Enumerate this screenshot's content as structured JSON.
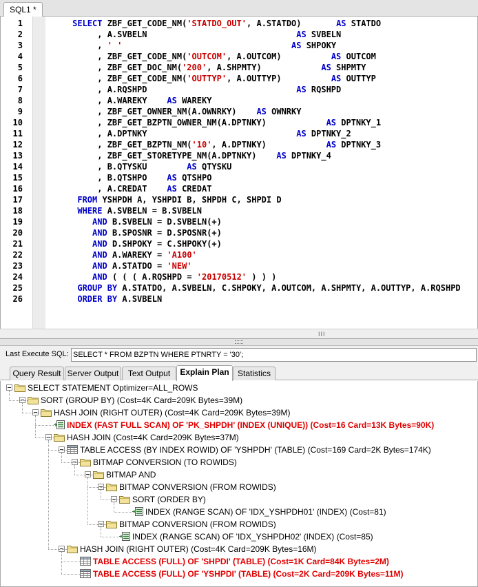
{
  "editor": {
    "tab_label": "SQL1 *",
    "scroll_grip": "III",
    "lines": [
      {
        "n": "1",
        "t": [
          [
            "     "
          ],
          [
            "SELECT",
            "kw"
          ],
          [
            " ZBF_GET_CODE_NM("
          ],
          [
            "'STATDO_OUT'",
            "str"
          ],
          [
            ", A.STATDO)       "
          ],
          [
            "AS",
            "kw"
          ],
          [
            " STATDO"
          ]
        ]
      },
      {
        "n": "2",
        "t": [
          [
            "          , A.SVBELN                              "
          ],
          [
            "AS",
            "kw"
          ],
          [
            " SVBELN"
          ]
        ]
      },
      {
        "n": "3",
        "t": [
          [
            "          , "
          ],
          [
            "' '",
            "str"
          ],
          [
            "                                  "
          ],
          [
            "AS",
            "kw"
          ],
          [
            " SHPOKY"
          ]
        ]
      },
      {
        "n": "4",
        "t": [
          [
            "          , ZBF_GET_CODE_NM("
          ],
          [
            "'OUTCOM'",
            "str"
          ],
          [
            ", A.OUTCOM)          "
          ],
          [
            "AS",
            "kw"
          ],
          [
            " OUTCOM"
          ]
        ]
      },
      {
        "n": "5",
        "t": [
          [
            "          , ZBF_GET_DOC_NM("
          ],
          [
            "'200'",
            "str"
          ],
          [
            ", A.SHPMTY)            "
          ],
          [
            "AS",
            "kw"
          ],
          [
            " SHPMTY"
          ]
        ]
      },
      {
        "n": "6",
        "t": [
          [
            "          , ZBF_GET_CODE_NM("
          ],
          [
            "'OUTTYP'",
            "str"
          ],
          [
            ", A.OUTTYP)          "
          ],
          [
            "AS",
            "kw"
          ],
          [
            " OUTTYP"
          ]
        ]
      },
      {
        "n": "7",
        "t": [
          [
            "          , A.RQSHPD                              "
          ],
          [
            "AS",
            "kw"
          ],
          [
            " RQSHPD"
          ]
        ]
      },
      {
        "n": "8",
        "t": [
          [
            "          , A.WAREKY    "
          ],
          [
            "AS",
            "kw"
          ],
          [
            " WAREKY"
          ]
        ]
      },
      {
        "n": "9",
        "t": [
          [
            "          , ZBF_GET_OWNER_NM(A.OWNRKY)    "
          ],
          [
            "AS",
            "kw"
          ],
          [
            " OWNRKY"
          ]
        ]
      },
      {
        "n": "10",
        "t": [
          [
            "          , ZBF_GET_BZPTN_OWNER_NM(A.DPTNKY)            "
          ],
          [
            "AS",
            "kw"
          ],
          [
            " DPTNKY_1"
          ]
        ]
      },
      {
        "n": "11",
        "t": [
          [
            "          , A.DPTNKY                              "
          ],
          [
            "AS",
            "kw"
          ],
          [
            " DPTNKY_2"
          ]
        ]
      },
      {
        "n": "12",
        "t": [
          [
            "          , ZBF_GET_BZPTN_NM("
          ],
          [
            "'10'",
            "str"
          ],
          [
            ", A.DPTNKY)            "
          ],
          [
            "AS",
            "kw"
          ],
          [
            " DPTNKY_3"
          ]
        ]
      },
      {
        "n": "13",
        "t": [
          [
            "          , ZBF_GET_STORETYPE_NM(A.DPTNKY)    "
          ],
          [
            "AS",
            "kw"
          ],
          [
            " DPTNKY_4"
          ]
        ]
      },
      {
        "n": "14",
        "t": [
          [
            "          , B.QTYSKU        "
          ],
          [
            "AS",
            "kw"
          ],
          [
            " QTYSKU"
          ]
        ]
      },
      {
        "n": "15",
        "t": [
          [
            "          , B.QTSHPO    "
          ],
          [
            "AS",
            "kw"
          ],
          [
            " QTSHPO"
          ]
        ]
      },
      {
        "n": "16",
        "t": [
          [
            "          , A.CREDAT    "
          ],
          [
            "AS",
            "kw"
          ],
          [
            " CREDAT"
          ]
        ]
      },
      {
        "n": "17",
        "t": [
          [
            "      "
          ],
          [
            "FROM",
            "kw"
          ],
          [
            " YSHPDH A, YSHPDI B, SHPDH C, SHPDI D"
          ]
        ]
      },
      {
        "n": "18",
        "t": [
          [
            "      "
          ],
          [
            "WHERE",
            "kw"
          ],
          [
            " A.SVBELN = B.SVBELN"
          ]
        ]
      },
      {
        "n": "19",
        "t": [
          [
            "         "
          ],
          [
            "AND",
            "kw"
          ],
          [
            " B.SVBELN = D.SVBELN(+)"
          ]
        ]
      },
      {
        "n": "20",
        "t": [
          [
            "         "
          ],
          [
            "AND",
            "kw"
          ],
          [
            " B.SPOSNR = D.SPOSNR(+)"
          ]
        ]
      },
      {
        "n": "21",
        "t": [
          [
            "         "
          ],
          [
            "AND",
            "kw"
          ],
          [
            " D.SHPOKY = C.SHPOKY(+)"
          ]
        ]
      },
      {
        "n": "22",
        "t": [
          [
            "         "
          ],
          [
            "AND",
            "kw"
          ],
          [
            " A.WAREKY = "
          ],
          [
            "'A100'",
            "str"
          ]
        ]
      },
      {
        "n": "23",
        "t": [
          [
            "         "
          ],
          [
            "AND",
            "kw"
          ],
          [
            " A.STATDO = "
          ],
          [
            "'NEW'",
            "str"
          ]
        ]
      },
      {
        "n": "24",
        "t": [
          [
            "         "
          ],
          [
            "AND",
            "kw"
          ],
          [
            " ( ( ( A.RQSHPD = "
          ],
          [
            "'20170512'",
            "str"
          ],
          [
            " ) ) )"
          ]
        ]
      },
      {
        "n": "25",
        "t": [
          [
            "      "
          ],
          [
            "GROUP BY",
            "kw"
          ],
          [
            " A.STATDO, A.SVBELN, C.SHPOKY, A.OUTCOM, A.SHPMTY, A.OUTTYP, A.RQSHPD"
          ]
        ]
      },
      {
        "n": "26",
        "t": [
          [
            "      "
          ],
          [
            "ORDER BY",
            "kw"
          ],
          [
            " A.SVBELN"
          ]
        ]
      }
    ]
  },
  "last_execute": {
    "label": "Last Execute SQL:",
    "value": "SELECT * FROM BZPTN WHERE PTNRTY = '30';"
  },
  "result_tabs": [
    {
      "label": "Query Result",
      "active": false
    },
    {
      "label": "Server Output",
      "active": false
    },
    {
      "label": "Text Output",
      "active": false
    },
    {
      "label": "Explain Plan",
      "active": true
    },
    {
      "label": "Statistics",
      "active": false
    }
  ],
  "plan": [
    {
      "depth": 0,
      "icon": "folder",
      "text": "SELECT STATEMENT Optimizer=ALL_ROWS",
      "red": false
    },
    {
      "depth": 1,
      "icon": "folder",
      "text": "SORT (GROUP BY) (Cost=4K Card=209K Bytes=39M)",
      "red": false
    },
    {
      "depth": 2,
      "icon": "folder",
      "text": "HASH JOIN (RIGHT OUTER) (Cost=4K Card=209K Bytes=39M)",
      "red": false
    },
    {
      "depth": 3,
      "icon": "index",
      "text": "INDEX (FAST FULL SCAN) OF 'PK_SHPDH' (INDEX (UNIQUE)) (Cost=16 Card=13K Bytes=90K)",
      "red": true
    },
    {
      "depth": 3,
      "icon": "folder",
      "text": "HASH JOIN (Cost=4K Card=209K Bytes=37M)",
      "red": false
    },
    {
      "depth": 4,
      "icon": "table",
      "text": "TABLE ACCESS (BY INDEX ROWID) OF 'YSHPDH' (TABLE) (Cost=169 Card=2K Bytes=174K)",
      "red": false
    },
    {
      "depth": 5,
      "icon": "folder",
      "text": "BITMAP CONVERSION (TO ROWIDS)",
      "red": false
    },
    {
      "depth": 6,
      "icon": "folder",
      "text": "BITMAP AND",
      "red": false
    },
    {
      "depth": 7,
      "icon": "folder",
      "text": "BITMAP CONVERSION (FROM ROWIDS)",
      "red": false
    },
    {
      "depth": 8,
      "icon": "folder",
      "text": "SORT (ORDER BY)",
      "red": false
    },
    {
      "depth": 9,
      "icon": "index",
      "text": "INDEX (RANGE SCAN) OF 'IDX_YSHPDH01' (INDEX) (Cost=81)",
      "red": false
    },
    {
      "depth": 7,
      "icon": "folder",
      "text": "BITMAP CONVERSION (FROM ROWIDS)",
      "red": false
    },
    {
      "depth": 8,
      "icon": "index",
      "text": "INDEX (RANGE SCAN) OF 'IDX_YSHPDH02' (INDEX) (Cost=85)",
      "red": false
    },
    {
      "depth": 4,
      "icon": "folder",
      "text": "HASH JOIN (RIGHT OUTER) (Cost=4K Card=209K Bytes=16M)",
      "red": false
    },
    {
      "depth": 5,
      "icon": "table",
      "text": "TABLE ACCESS (FULL) OF 'SHPDI' (TABLE) (Cost=1K Card=84K Bytes=2M)",
      "red": true
    },
    {
      "depth": 5,
      "icon": "table",
      "text": "TABLE ACCESS (FULL) OF 'YSHPDI' (TABLE) (Cost=2K Card=209K Bytes=11M)",
      "red": true
    }
  ]
}
